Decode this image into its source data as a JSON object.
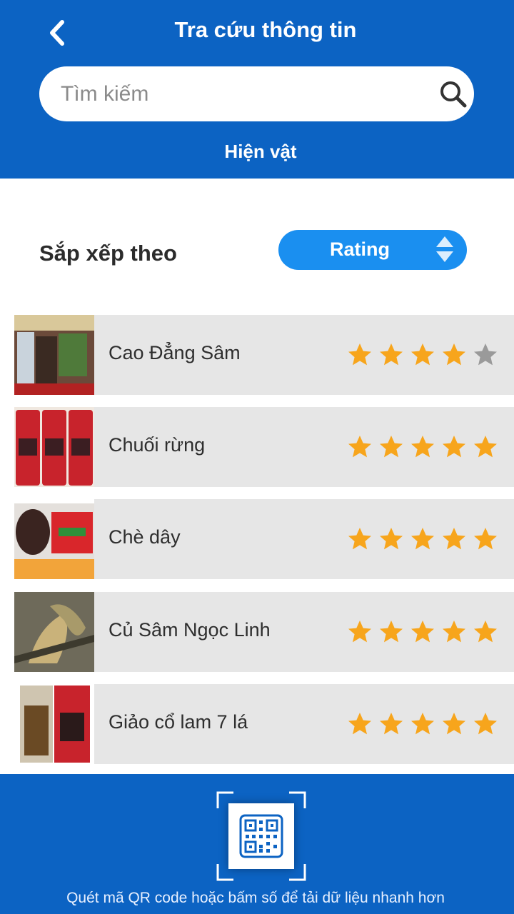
{
  "header": {
    "title": "Tra cứu thông tin",
    "subtitle": "Hiện vật",
    "search_placeholder": "Tìm kiếm"
  },
  "sort": {
    "label": "Sắp xếp theo",
    "selected": "Rating"
  },
  "items": [
    {
      "name": "Cao Đẳng Sâm",
      "rating": 4
    },
    {
      "name": "Chuối rừng",
      "rating": 5
    },
    {
      "name": "Chè dây",
      "rating": 5
    },
    {
      "name": "Củ Sâm Ngọc Linh",
      "rating": 5
    },
    {
      "name": "Giảo cổ lam 7 lá",
      "rating": 5
    }
  ],
  "footer": {
    "hint": "Quét mã QR code hoặc bấm số để tải dữ liệu nhanh hơn"
  },
  "colors": {
    "primary": "#0c63c3",
    "accent": "#1a8ff0",
    "star_filled": "#f7a51c",
    "star_empty": "#9a9a9a",
    "row_bg": "#e6e6e6"
  }
}
